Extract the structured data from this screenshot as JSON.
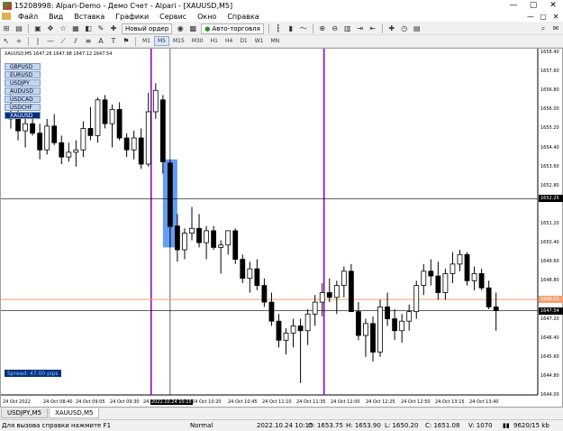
{
  "window": {
    "title": "15208998: Alpari-Demo - Демо Счет - Alpari - [XAUUSD,M5]",
    "controls": [
      "—",
      "▢",
      "✕"
    ]
  },
  "menu": {
    "items": [
      "Файл",
      "Вид",
      "Вставка",
      "Графики",
      "Сервис",
      "Окно",
      "Справка"
    ],
    "mdi_controls": [
      "—",
      "▢",
      "✕"
    ]
  },
  "toolbar": {
    "new_order": "Новый ордер",
    "autotrading": "Авто-торговля",
    "timeframes": [
      "M1",
      "M5",
      "M15",
      "M30",
      "H1",
      "H4",
      "D1",
      "W1",
      "MN"
    ],
    "active_timeframe": "M5"
  },
  "chart": {
    "header": "XAUUSD,M5  1647.26 1647.98 1647.12 1647.54",
    "symbols": [
      "GBPUSD",
      "EURUSD",
      "USDJPY",
      "AUDUSD",
      "USDCAD",
      "USDCHF",
      "XAUUSD"
    ],
    "selected_symbol": "XAUUSD",
    "spread": "Spread: 47.00 pips",
    "price_ticks": [
      "1658.40",
      "1657.60",
      "1656.80",
      "1656.00",
      "1655.20",
      "1654.40",
      "1653.60",
      "1652.80",
      "1651.20",
      "1650.40",
      "1649.60",
      "1648.80",
      "1647.20",
      "1646.40",
      "1645.60",
      "1644.80",
      "1644.00"
    ],
    "crosshair_price": "1652.25",
    "bid_price": "1648.01",
    "ask_price": "1647.54",
    "time_ticks": [
      "24 Oct 2022",
      "24 Oct 08:40",
      "24 Oct 09:05",
      "24 Oct 09:30",
      "24",
      "24 Oct 10:20",
      "24 Oct 10:45",
      "24 Oct 11:10",
      "24 Oct 11:35",
      "24 Oct 12:00",
      "24 Oct 12:25",
      "24 Oct 12:50",
      "24 Oct 13:15",
      "24 Oct 13:40"
    ],
    "crosshair_time": "2022.10.24 10:15",
    "colors": {
      "bull": "#ffffff",
      "bear": "#000000",
      "vline": "#8000c0",
      "bid": "#f4a070",
      "ask": "#000000",
      "highlight": "#4a8cf0"
    }
  },
  "tabs": [
    "USDJPY,M5",
    "XAUUSD,M5"
  ],
  "active_tab": "XAUUSD,M5",
  "status": {
    "help": "Для вызова справки нажмите F1",
    "mode": "Normal",
    "time": "2022.10.24 10:15",
    "open": "O: 1653.75",
    "high": "H: 1653.90",
    "low": "L: 1650.20",
    "close": "C: 1651.08",
    "volume": "V: 1070",
    "traffic": "9620/15 kb"
  },
  "chart_data": {
    "type": "candlestick",
    "symbol": "XAUUSD",
    "timeframe": "M5",
    "candles": [
      {
        "o": 1655.8,
        "h": 1656.6,
        "l": 1655.2,
        "c": 1655.6
      },
      {
        "o": 1655.6,
        "h": 1656.2,
        "l": 1654.7,
        "c": 1655.1
      },
      {
        "o": 1655.1,
        "h": 1655.7,
        "l": 1654.4,
        "c": 1655.4
      },
      {
        "o": 1655.4,
        "h": 1655.8,
        "l": 1654.9,
        "c": 1655.0
      },
      {
        "o": 1655.0,
        "h": 1655.4,
        "l": 1653.9,
        "c": 1654.3
      },
      {
        "o": 1654.3,
        "h": 1655.6,
        "l": 1654.1,
        "c": 1655.3
      },
      {
        "o": 1655.3,
        "h": 1655.8,
        "l": 1654.5,
        "c": 1654.6
      },
      {
        "o": 1654.6,
        "h": 1654.9,
        "l": 1653.7,
        "c": 1654.0
      },
      {
        "o": 1654.0,
        "h": 1654.6,
        "l": 1653.8,
        "c": 1654.2
      },
      {
        "o": 1654.2,
        "h": 1654.7,
        "l": 1653.6,
        "c": 1654.3
      },
      {
        "o": 1654.3,
        "h": 1655.5,
        "l": 1654.0,
        "c": 1655.2
      },
      {
        "o": 1655.2,
        "h": 1656.1,
        "l": 1654.7,
        "c": 1654.9
      },
      {
        "o": 1654.9,
        "h": 1656.5,
        "l": 1654.6,
        "c": 1656.4
      },
      {
        "o": 1656.4,
        "h": 1656.6,
        "l": 1655.2,
        "c": 1655.4
      },
      {
        "o": 1655.4,
        "h": 1656.2,
        "l": 1654.4,
        "c": 1656.0
      },
      {
        "o": 1656.0,
        "h": 1656.3,
        "l": 1654.7,
        "c": 1654.8
      },
      {
        "o": 1654.8,
        "h": 1655.0,
        "l": 1654.0,
        "c": 1654.3
      },
      {
        "o": 1654.3,
        "h": 1655.1,
        "l": 1653.9,
        "c": 1654.8
      },
      {
        "o": 1654.8,
        "h": 1655.2,
        "l": 1653.5,
        "c": 1653.7
      },
      {
        "o": 1653.7,
        "h": 1656.7,
        "l": 1653.6,
        "c": 1655.9
      },
      {
        "o": 1655.9,
        "h": 1657.1,
        "l": 1655.6,
        "c": 1656.8
      },
      {
        "o": 1656.4,
        "h": 1656.6,
        "l": 1653.3,
        "c": 1653.8
      },
      {
        "o": 1653.75,
        "h": 1653.9,
        "l": 1650.2,
        "c": 1651.08
      },
      {
        "o": 1651.1,
        "h": 1651.6,
        "l": 1649.6,
        "c": 1650.1
      },
      {
        "o": 1650.1,
        "h": 1651.0,
        "l": 1649.7,
        "c": 1650.8
      },
      {
        "o": 1650.8,
        "h": 1651.9,
        "l": 1650.5,
        "c": 1651.0
      },
      {
        "o": 1651.0,
        "h": 1651.6,
        "l": 1650.2,
        "c": 1650.4
      },
      {
        "o": 1650.4,
        "h": 1651.1,
        "l": 1649.7,
        "c": 1650.9
      },
      {
        "o": 1650.9,
        "h": 1651.1,
        "l": 1650.1,
        "c": 1650.2
      },
      {
        "o": 1650.2,
        "h": 1650.5,
        "l": 1649.1,
        "c": 1650.3
      },
      {
        "o": 1650.3,
        "h": 1650.9,
        "l": 1649.9,
        "c": 1650.9
      },
      {
        "o": 1650.9,
        "h": 1651.0,
        "l": 1649.5,
        "c": 1649.7
      },
      {
        "o": 1649.7,
        "h": 1649.9,
        "l": 1648.7,
        "c": 1648.9
      },
      {
        "o": 1648.9,
        "h": 1649.6,
        "l": 1648.3,
        "c": 1649.3
      },
      {
        "o": 1649.3,
        "h": 1649.7,
        "l": 1648.4,
        "c": 1648.6
      },
      {
        "o": 1648.6,
        "h": 1648.9,
        "l": 1647.7,
        "c": 1647.9
      },
      {
        "o": 1647.9,
        "h": 1648.3,
        "l": 1646.9,
        "c": 1647.1
      },
      {
        "o": 1647.1,
        "h": 1647.4,
        "l": 1646.0,
        "c": 1646.3
      },
      {
        "o": 1646.3,
        "h": 1646.8,
        "l": 1645.7,
        "c": 1646.6
      },
      {
        "o": 1646.6,
        "h": 1647.2,
        "l": 1646.0,
        "c": 1646.9
      },
      {
        "o": 1646.9,
        "h": 1647.2,
        "l": 1644.5,
        "c": 1646.7
      },
      {
        "o": 1646.7,
        "h": 1647.6,
        "l": 1646.1,
        "c": 1647.4
      },
      {
        "o": 1647.4,
        "h": 1648.2,
        "l": 1646.9,
        "c": 1647.9
      },
      {
        "o": 1647.9,
        "h": 1648.7,
        "l": 1647.3,
        "c": 1648.3
      },
      {
        "o": 1648.3,
        "h": 1648.9,
        "l": 1647.9,
        "c": 1648.1
      },
      {
        "o": 1648.1,
        "h": 1648.8,
        "l": 1647.4,
        "c": 1648.6
      },
      {
        "o": 1648.6,
        "h": 1649.4,
        "l": 1648.1,
        "c": 1649.2
      },
      {
        "o": 1649.2,
        "h": 1649.5,
        "l": 1647.5,
        "c": 1647.5
      },
      {
        "o": 1647.5,
        "h": 1647.9,
        "l": 1646.3,
        "c": 1646.5
      },
      {
        "o": 1646.5,
        "h": 1647.2,
        "l": 1645.6,
        "c": 1647.0
      },
      {
        "o": 1647.0,
        "h": 1647.3,
        "l": 1645.4,
        "c": 1645.8
      },
      {
        "o": 1645.8,
        "h": 1648.0,
        "l": 1645.6,
        "c": 1647.7
      },
      {
        "o": 1647.7,
        "h": 1648.3,
        "l": 1646.9,
        "c": 1647.2
      },
      {
        "o": 1647.2,
        "h": 1647.6,
        "l": 1646.3,
        "c": 1646.7
      },
      {
        "o": 1646.7,
        "h": 1647.4,
        "l": 1646.2,
        "c": 1647.1
      },
      {
        "o": 1647.1,
        "h": 1647.8,
        "l": 1646.7,
        "c": 1647.5
      },
      {
        "o": 1647.5,
        "h": 1648.8,
        "l": 1647.2,
        "c": 1648.6
      },
      {
        "o": 1648.6,
        "h": 1649.5,
        "l": 1648.2,
        "c": 1649.2
      },
      {
        "o": 1649.2,
        "h": 1649.7,
        "l": 1648.6,
        "c": 1649.0
      },
      {
        "o": 1649.0,
        "h": 1649.6,
        "l": 1648.0,
        "c": 1648.3
      },
      {
        "o": 1648.3,
        "h": 1649.3,
        "l": 1648.0,
        "c": 1649.1
      },
      {
        "o": 1649.1,
        "h": 1650.0,
        "l": 1648.7,
        "c": 1649.5
      },
      {
        "o": 1649.5,
        "h": 1650.1,
        "l": 1649.2,
        "c": 1649.9
      },
      {
        "o": 1649.9,
        "h": 1650.0,
        "l": 1648.6,
        "c": 1648.8
      },
      {
        "o": 1648.8,
        "h": 1649.4,
        "l": 1648.4,
        "c": 1649.1
      },
      {
        "o": 1649.1,
        "h": 1649.3,
        "l": 1648.4,
        "c": 1648.5
      },
      {
        "o": 1648.5,
        "h": 1648.8,
        "l": 1647.6,
        "c": 1647.7
      },
      {
        "o": 1647.7,
        "h": 1648.3,
        "l": 1646.7,
        "c": 1647.54
      }
    ],
    "ylim": [
      1644.0,
      1658.4
    ],
    "horizontal_lines": {
      "crosshair": 1652.25,
      "bid": 1648.01,
      "ask": 1647.54
    },
    "highlighted_candle_index": 22
  }
}
